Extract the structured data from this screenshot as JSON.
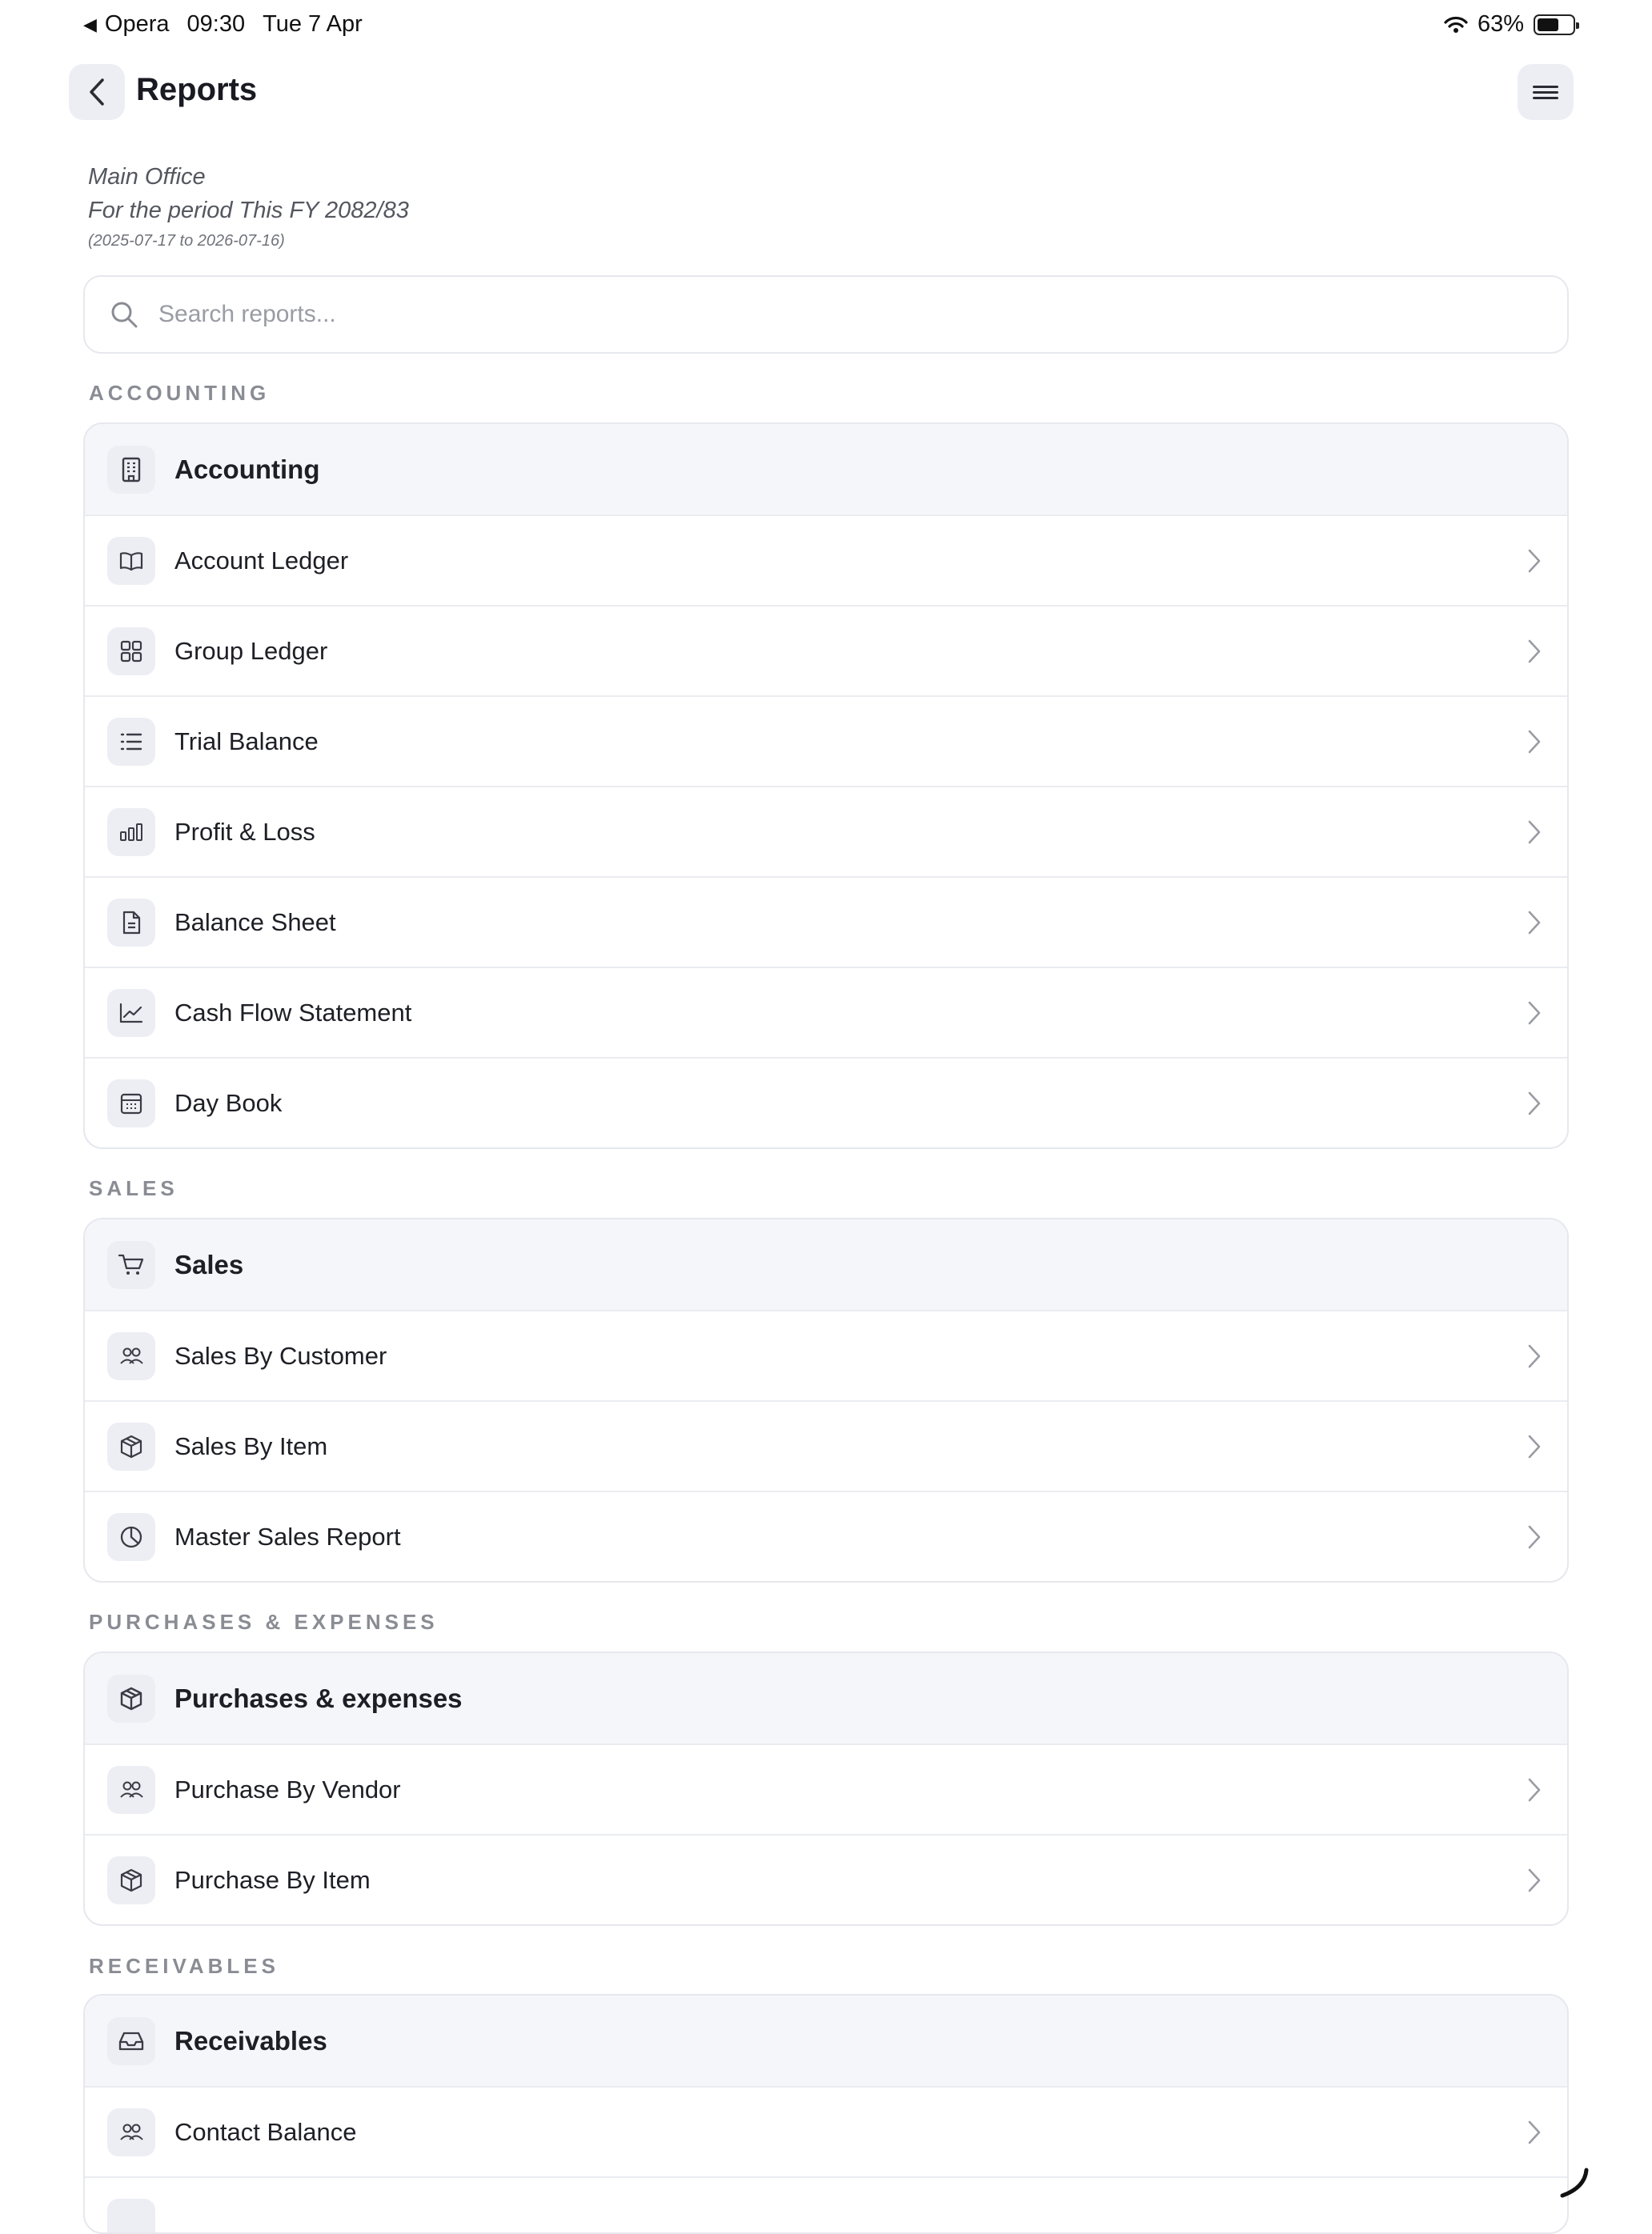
{
  "status_bar": {
    "back_app": "Opera",
    "time": "09:30",
    "date": "Tue 7 Apr",
    "battery_percent": "63%",
    "battery_level": 0.63
  },
  "header": {
    "title": "Reports",
    "back_icon": "chevron-left-icon",
    "menu_icon": "hamburger-menu-icon"
  },
  "context": {
    "office": "Main Office",
    "period": "For the period This FY 2082/83",
    "range": "(2025-07-17 to 2026-07-16)"
  },
  "search": {
    "placeholder": "Search reports...",
    "value": ""
  },
  "sections": [
    {
      "label": "ACCOUNTING",
      "header": {
        "label": "Accounting",
        "icon": "building-icon"
      },
      "items": [
        {
          "label": "Account Ledger",
          "icon": "book-open-icon"
        },
        {
          "label": "Group Ledger",
          "icon": "grid-icon"
        },
        {
          "label": "Trial Balance",
          "icon": "list-icon"
        },
        {
          "label": "Profit & Loss",
          "icon": "bar-chart-icon"
        },
        {
          "label": "Balance Sheet",
          "icon": "file-text-icon"
        },
        {
          "label": "Cash Flow Statement",
          "icon": "line-chart-icon"
        },
        {
          "label": "Day Book",
          "icon": "calendar-icon"
        }
      ]
    },
    {
      "label": "SALES",
      "header": {
        "label": "Sales",
        "icon": "cart-icon"
      },
      "items": [
        {
          "label": "Sales By Customer",
          "icon": "users-icon"
        },
        {
          "label": "Sales By Item",
          "icon": "package-icon"
        },
        {
          "label": "Master Sales Report",
          "icon": "pie-chart-icon"
        }
      ]
    },
    {
      "label": "PURCHASES & EXPENSES",
      "header": {
        "label": "Purchases & expenses",
        "icon": "package-icon"
      },
      "items": [
        {
          "label": "Purchase By Vendor",
          "icon": "users-icon"
        },
        {
          "label": "Purchase By Item",
          "icon": "package-icon"
        }
      ]
    },
    {
      "label": "RECEIVABLES",
      "header": {
        "label": "Receivables",
        "icon": "inbox-icon"
      },
      "items": [
        {
          "label": "Contact Balance",
          "icon": "users-icon"
        },
        {
          "label": "",
          "icon": ""
        }
      ]
    }
  ]
}
